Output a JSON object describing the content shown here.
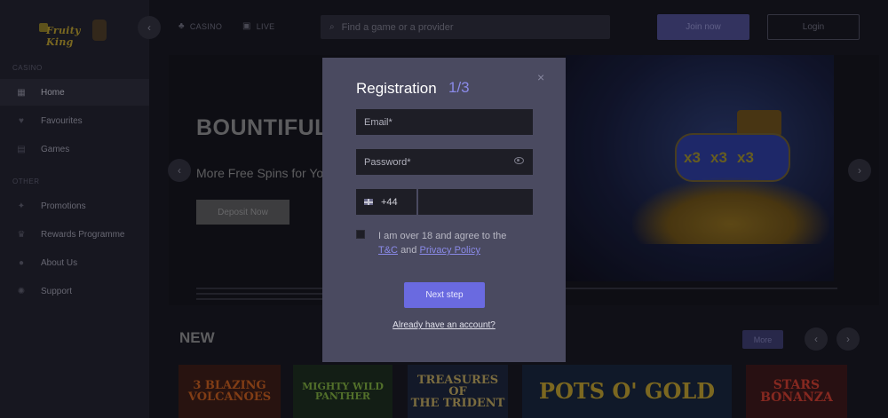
{
  "brand": {
    "logo_text": "Fruity King"
  },
  "sidebar": {
    "section_casino": "CASINO",
    "section_other": "OTHER",
    "items": [
      {
        "label": "Home",
        "icon": "grid-icon"
      },
      {
        "label": "Favourites",
        "icon": "heart-icon"
      },
      {
        "label": "Games",
        "icon": "slot-icon"
      },
      {
        "label": "Promotions",
        "icon": "gift-icon"
      },
      {
        "label": "Rewards Programme",
        "icon": "trophy-icon"
      },
      {
        "label": "About Us",
        "icon": "info-icon"
      },
      {
        "label": "Support",
        "icon": "gear-icon"
      }
    ]
  },
  "topnav": {
    "casino": "CASINO",
    "live": "LIVE",
    "search_placeholder": "Find a game or a provider",
    "join": "Join now",
    "login": "Login"
  },
  "hero": {
    "title": "BOUNTIFUL",
    "subtitle": "More Free Spins for Yo",
    "cta": "Deposit Now",
    "slot_symbols": [
      "x3",
      "x3",
      "x3"
    ]
  },
  "new_section": {
    "title": "NEW",
    "more": "More",
    "games": [
      {
        "line1": "3 BLAZING",
        "line2": "VOLCANOES",
        "color": "#c25a1a"
      },
      {
        "line1": "MIGHTY WILD",
        "line2": "PANTHER",
        "color": "#7aa83a"
      },
      {
        "line1": "TREASURES OF",
        "line2": "THE TRIDENT",
        "color": "#b8a25a"
      },
      {
        "line1": "POTS O' GOLD",
        "line2": "",
        "color": "#b89a2a"
      },
      {
        "line1": "STARS",
        "line2": "BONANZA",
        "color": "#c83a2a"
      }
    ]
  },
  "modal": {
    "title": "Registration",
    "step": "1/3",
    "close": "×",
    "email_placeholder": "Email*",
    "password_placeholder": "Password*",
    "phone_code": "+44",
    "agree_text": "I am over 18 and agree to the",
    "tc": "T&C",
    "and": "and",
    "privacy": "Privacy Policy",
    "next": "Next step",
    "already": "Already have an account?"
  }
}
